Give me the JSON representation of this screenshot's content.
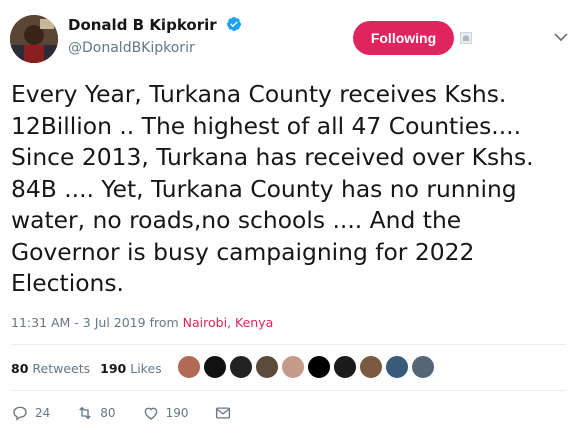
{
  "user": {
    "name": "Donald B Kipkorir",
    "handle": "@DonaldBKipkorir",
    "verified": true
  },
  "follow_button": {
    "label": "Following"
  },
  "tweet": {
    "text": "Every Year, Turkana County receives Kshs.\n12Billion .. The highest of all 47 Counties....\nSince 2013, Turkana has received over Kshs.\n84B .... Yet, Turkana County has no running\nwater, no roads,no schools .... And the\nGovernor is busy campaigning for 2022\nElections."
  },
  "meta": {
    "time": "11:31 AM - 3 Jul 2019",
    "from_label": "from",
    "location": "Nairobi, Kenya"
  },
  "stats": {
    "retweets_count": "80",
    "retweets_label": "Retweets",
    "likes_count": "190",
    "likes_label": "Likes"
  },
  "likers": [
    {
      "color": "#b06a55"
    },
    {
      "color": "#111111"
    },
    {
      "color": "#222222"
    },
    {
      "color": "#5a4a3a"
    },
    {
      "color": "#c49a8a"
    },
    {
      "color": "#000000"
    },
    {
      "color": "#1a1a1a"
    },
    {
      "color": "#7a5a40"
    },
    {
      "color": "#3a5a7a"
    },
    {
      "color": "#556677"
    }
  ],
  "actions": {
    "reply_count": "24",
    "retweet_count": "80",
    "like_count": "190"
  },
  "colors": {
    "accent": "#e0245e",
    "verified": "#1da1f2",
    "muted": "#657786"
  }
}
